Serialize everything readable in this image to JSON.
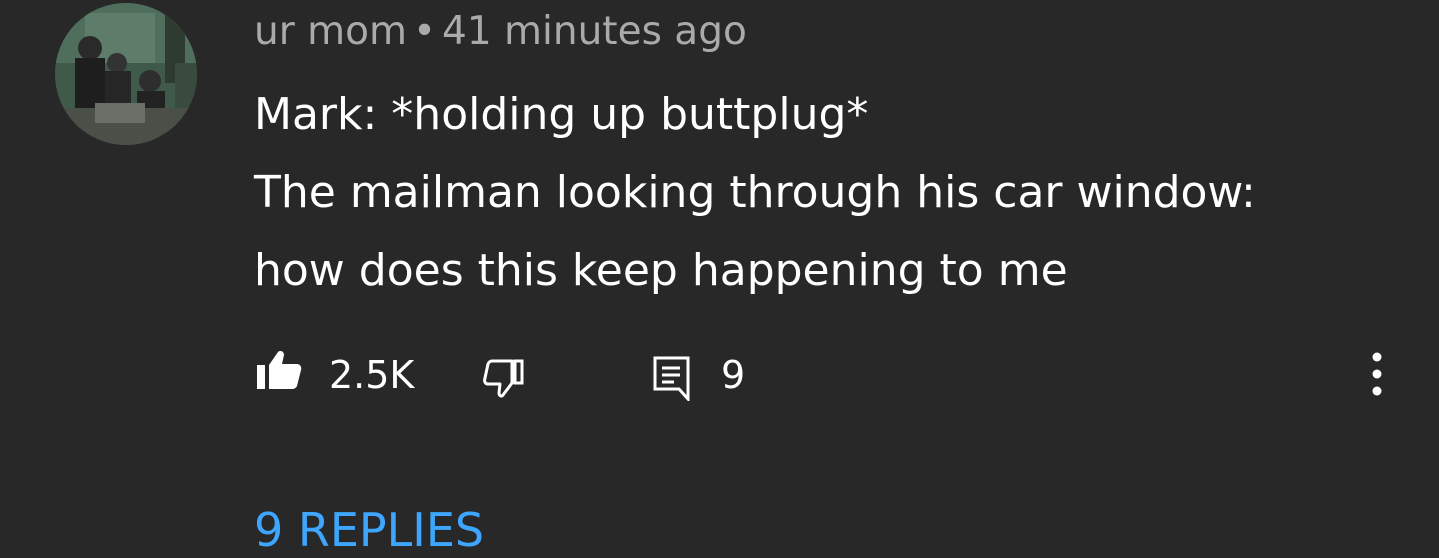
{
  "comment": {
    "author": "ur mom",
    "separator": "•",
    "time": "41 minutes ago",
    "lines": [
      "Mark: *holding up buttplug*",
      "The mailman looking through his car window:",
      "how does this keep happening to me"
    ]
  },
  "actions": {
    "like_icon": "thumbs-up-filled-icon",
    "like_count": "2.5K",
    "dislike_icon": "thumbs-down-outline-icon",
    "reply_icon": "comment-icon",
    "reply_count": "9",
    "more_icon": "more-vertical-icon"
  },
  "replies_link": "9 REPLIES",
  "colors": {
    "background": "#282828",
    "text": "#ffffff",
    "meta": "#aaaaaa",
    "link": "#3ea6ff"
  }
}
